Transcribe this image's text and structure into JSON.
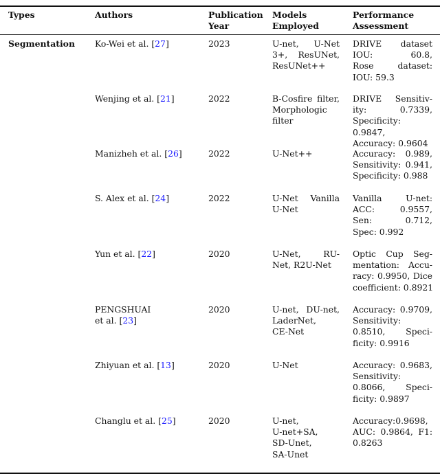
{
  "table": {
    "headers": [
      [
        "Types"
      ],
      [
        "Authors"
      ],
      [
        "Publication",
        "Year"
      ],
      [
        "Models",
        "Employed"
      ],
      [
        "Performance",
        "Assessment"
      ]
    ],
    "type_label": "Segmentation",
    "rows": [
      {
        "author": "Ko-Wei et al.",
        "ref": "27",
        "year": "2023",
        "models": [
          "U-net, U-Net",
          "3+, ResUNet,",
          "ResUNet++"
        ],
        "performance": [
          "DRIVE dataset",
          "IOU: 60.8,",
          "Rose dataset:",
          "IOU: 59.3"
        ]
      },
      {
        "author": "Wenjing et al.",
        "ref": "21",
        "year": "2022",
        "models": [
          "B-Cosfire filter,",
          "Morphologic",
          "filter"
        ],
        "performance": [
          "DRIVE Sensitiv-",
          "ity: 0.7339,",
          "Specificity: 0.9847,",
          "Accuracy: 0.9604"
        ]
      },
      {
        "author": "Manizheh et al.",
        "ref": "26",
        "year": "2022",
        "models": [
          "U-Net++"
        ],
        "performance": [
          "Accuracy: 0.989,",
          "Sensitivity: 0.941,",
          "Specificity: 0.988"
        ]
      },
      {
        "author": "S. Alex et al.",
        "ref": "24",
        "year": "2022",
        "models": [
          "U-Net Vanilla",
          "U-Net"
        ],
        "performance": [
          "Vanilla U-net:",
          "ACC: 0.9557,",
          "Sen: 0.712,",
          "Spec: 0.992"
        ]
      },
      {
        "author": "Yun et al.",
        "ref": "22",
        "year": "2020",
        "models": [
          "U-Net, RU-",
          "Net, R2U-Net"
        ],
        "performance": [
          "Optic Cup Seg-",
          "mentation: Accu-",
          "racy: 0.9950, Dice",
          "coefficient: 0.8921"
        ]
      },
      {
        "author_lines": [
          "PENGSHUAI",
          "et al."
        ],
        "ref": "23",
        "year": "2020",
        "models": [
          "U-net, DU-net,",
          "LaderNet,",
          "CE-Net"
        ],
        "performance": [
          "Accuracy: 0.9709,",
          "Sensitivity:",
          "0.8510, Speci-",
          "ficity: 0.9916"
        ]
      },
      {
        "author": "Zhiyuan et al.",
        "ref": "13",
        "year": "2020",
        "models": [
          "U-Net"
        ],
        "performance": [
          "Accuracy: 0.9683,",
          "Sensitivity:",
          "0.8066, Speci-",
          "ficity: 0.9897"
        ]
      },
      {
        "author": "Changlu et al.",
        "ref": "25",
        "year": "2020",
        "models": [
          "U-net,",
          "U-net+SA,",
          "SD-Unet,",
          "SA-Unet"
        ],
        "performance": [
          "Accuracy:0.9698,",
          "AUC: 0.9864, F1:",
          "0.8263"
        ]
      }
    ]
  }
}
